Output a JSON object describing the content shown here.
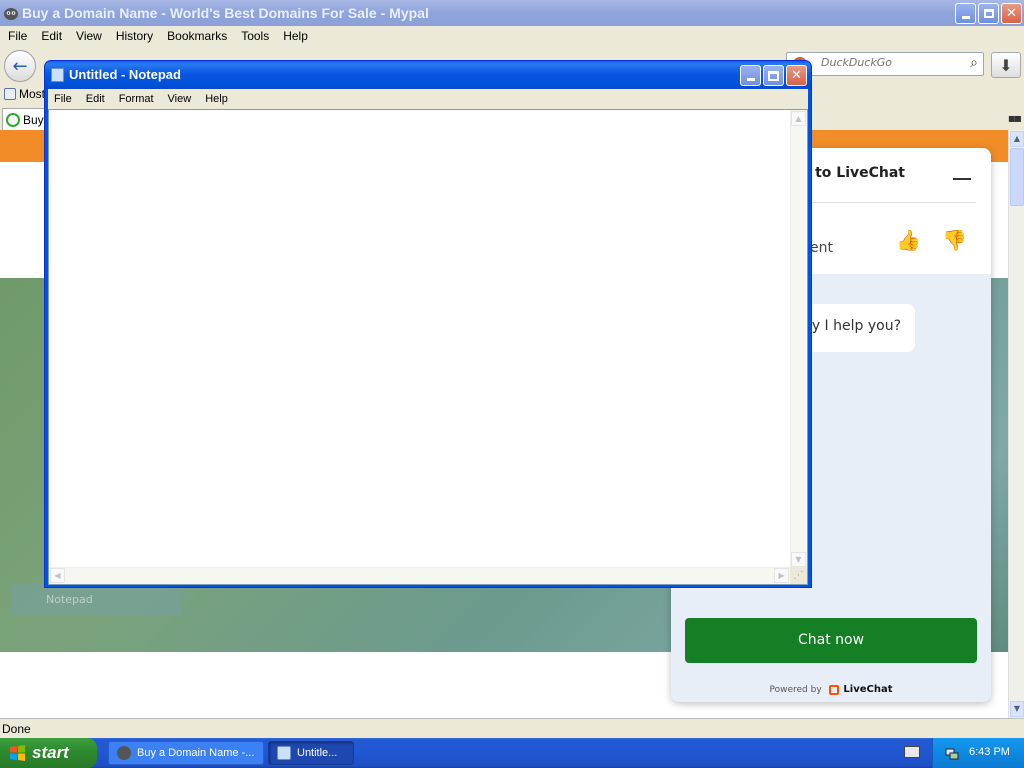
{
  "browser": {
    "title": "Buy a Domain Name - World's Best Domains For Sale - Mypal",
    "menu": [
      "File",
      "Edit",
      "View",
      "History",
      "Bookmarks",
      "Tools",
      "Help"
    ],
    "search_placeholder": "DuckDuckGo",
    "bookmark_most": "Most",
    "tab_label": "Buy",
    "status": "Done"
  },
  "livechat": {
    "title": "ne to LiveChat",
    "agent_text": "ent",
    "bubble_text": "ay I help you?",
    "chat_now": "Chat now",
    "powered_by": "Powered by",
    "brand": "LiveChat"
  },
  "page": {
    "ghost_taskbar_label": "Notepad"
  },
  "notepad": {
    "title": "Untitled - Notepad",
    "menu": [
      "File",
      "Edit",
      "Format",
      "View",
      "Help"
    ],
    "text": ""
  },
  "taskbar": {
    "start_label": "start",
    "tasks": [
      {
        "label": "Buy a Domain Name -..."
      },
      {
        "label": "Untitle..."
      }
    ],
    "clock": "6:43 PM"
  },
  "colors": {
    "accent_orange": "#f28c28",
    "chat_green": "#157f25",
    "xp_blue": "#0054e3",
    "start_green": "#2f8a2f"
  }
}
